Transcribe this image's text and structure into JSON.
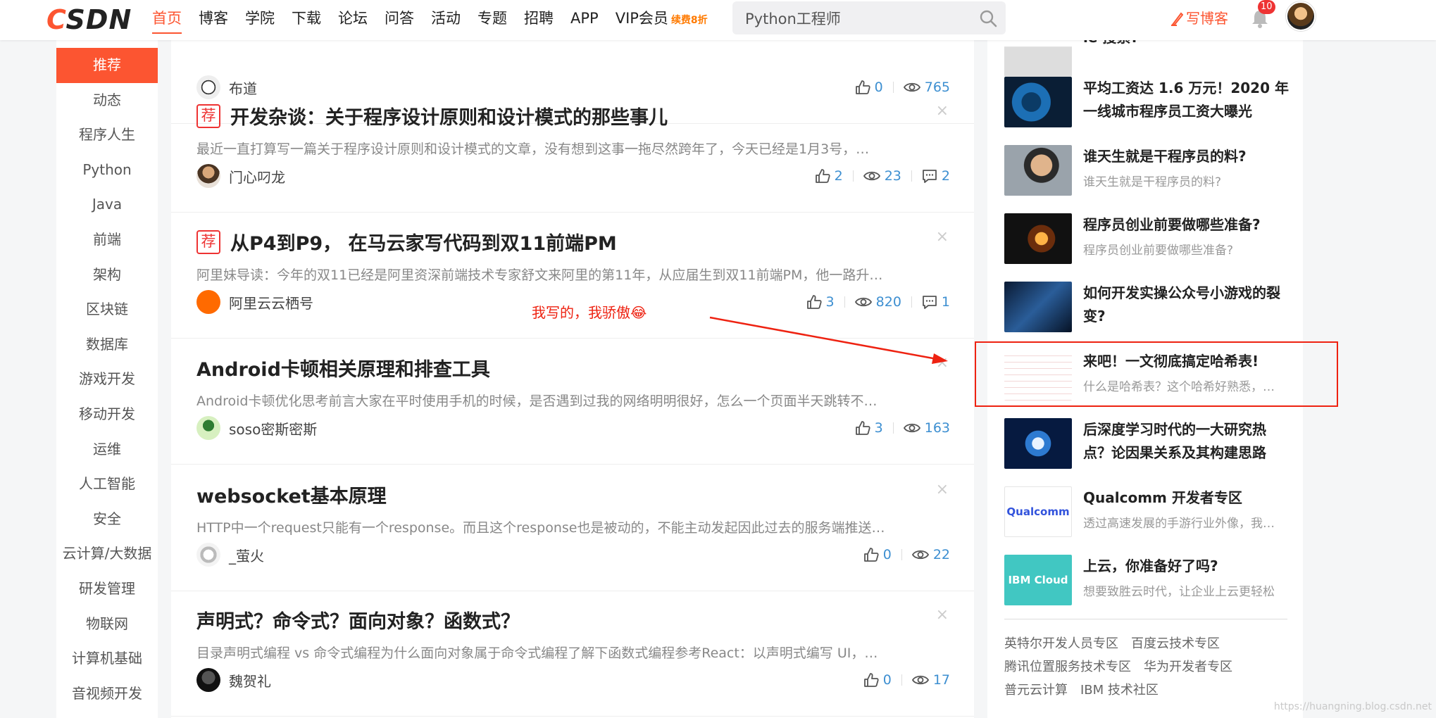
{
  "brand": {
    "logo_c": "C",
    "logo_rest": "SDN",
    "accent": "#fc5531"
  },
  "nav": [
    {
      "label": "首页",
      "active": true
    },
    {
      "label": "博客"
    },
    {
      "label": "学院"
    },
    {
      "label": "下载"
    },
    {
      "label": "论坛"
    },
    {
      "label": "问答"
    },
    {
      "label": "活动"
    },
    {
      "label": "专题"
    },
    {
      "label": "招聘"
    },
    {
      "label": "APP"
    },
    {
      "label": "VIP会员",
      "badge": "续费8折"
    }
  ],
  "search": {
    "value": "Python工程师",
    "icon": "search-icon"
  },
  "header_right": {
    "write_label": "写博客",
    "notif_count": "10"
  },
  "sidebar": [
    {
      "label": "推荐",
      "active": true
    },
    {
      "label": "动态"
    },
    {
      "label": "程序人生"
    },
    {
      "label": "Python"
    },
    {
      "label": "Java"
    },
    {
      "label": "前端"
    },
    {
      "label": "架构"
    },
    {
      "label": "区块链"
    },
    {
      "label": "数据库"
    },
    {
      "label": "游戏开发"
    },
    {
      "label": "移动开发"
    },
    {
      "label": "运维"
    },
    {
      "label": "人工智能"
    },
    {
      "label": "安全"
    },
    {
      "label": "云计算/大数据"
    },
    {
      "label": "研发管理"
    },
    {
      "label": "物联网"
    },
    {
      "label": "计算机基础"
    },
    {
      "label": "音视频开发"
    }
  ],
  "feed": [
    {
      "author": "布道",
      "likes": "0",
      "views": "765"
    },
    {
      "tag": "荐",
      "title": "开发杂谈：关于程序设计原则和设计模式的那些事儿",
      "summary": "最近一直打算写一篇关于程序设计原则和设计模式的文章，没有想到这事一拖尽然跨年了，今天已经是1月3号，…",
      "author": "门心叼龙",
      "likes": "2",
      "views": "23",
      "comments": "2"
    },
    {
      "tag": "荐",
      "title": "从P4到P9， 在马云家写代码到双11前端PM",
      "summary": "阿里妹导读：今年的双11已经是阿里资深前端技术专家舒文来阿里的第11年，从应届生到双11前端PM，他一路升…",
      "author": "阿里云云栖号",
      "likes": "3",
      "views": "820",
      "comments": "1"
    },
    {
      "title": "Android卡顿相关原理和排查工具",
      "summary": "Android卡顿优化思考前言大家在平时使用手机的时候，是否遇到过我的网络明明很好，怎么一个页面半天跳转不…",
      "author": "soso密斯密斯",
      "likes": "3",
      "views": "163"
    },
    {
      "title": "websocket基本原理",
      "summary": "HTTP中一个request只能有一个response。而且这个response也是被动的，不能主动发起因此过去的服务端推送…",
      "author": "_萤火",
      "likes": "0",
      "views": "22"
    },
    {
      "title": "声明式？命令式？面向对象？函数式？",
      "summary": "目录声明式编程 vs 命令式编程为什么面向对象属于命令式编程了解下函数式编程参考React：以声明式编写 UI，…",
      "author": "魏贺礼",
      "likes": "0",
      "views": "17"
    }
  ],
  "close_glyph": "×",
  "annotation": {
    "text": "我写的，我骄傲😂",
    "color": "#e21"
  },
  "recommend": [
    {
      "title": "le 搜索?",
      "subtitle": ""
    },
    {
      "title": "平均工资达 1.6 万元！2020 年一线城市程序员工资大曝光",
      "subtitle": ""
    },
    {
      "title": "谁天生就是干程序员的料?",
      "subtitle": "谁天生就是干程序员的料?"
    },
    {
      "title": "程序员创业前要做哪些准备?",
      "subtitle": "程序员创业前要做哪些准备?"
    },
    {
      "title": "如何开发实操公众号小游戏的裂变?",
      "subtitle": ""
    },
    {
      "title": "来吧！一文彻底搞定哈希表!",
      "subtitle": "什么是哈希表？这个哈希好熟悉，…",
      "highlighted": true
    },
    {
      "title": "后深度学习时代的一大研究热点？论因果关系及其构建思路",
      "subtitle": ""
    },
    {
      "title": "Qualcomm 开发者专区",
      "subtitle": "透过高速发展的手游行业外像，我…",
      "thumb_text": "Qualcomm"
    },
    {
      "title": "上云，你准备好了吗?",
      "subtitle": "想要致胜云时代，让企业上云更轻松",
      "thumb_text": "IBM Cloud"
    }
  ],
  "zones": [
    "英特尔开发人员专区",
    "百度云技术专区",
    "腾讯位置服务技术专区",
    "华为开发者专区",
    "普元云计算",
    "IBM 技术社区"
  ],
  "watermark": "https://huangning.blog.csdn.net"
}
